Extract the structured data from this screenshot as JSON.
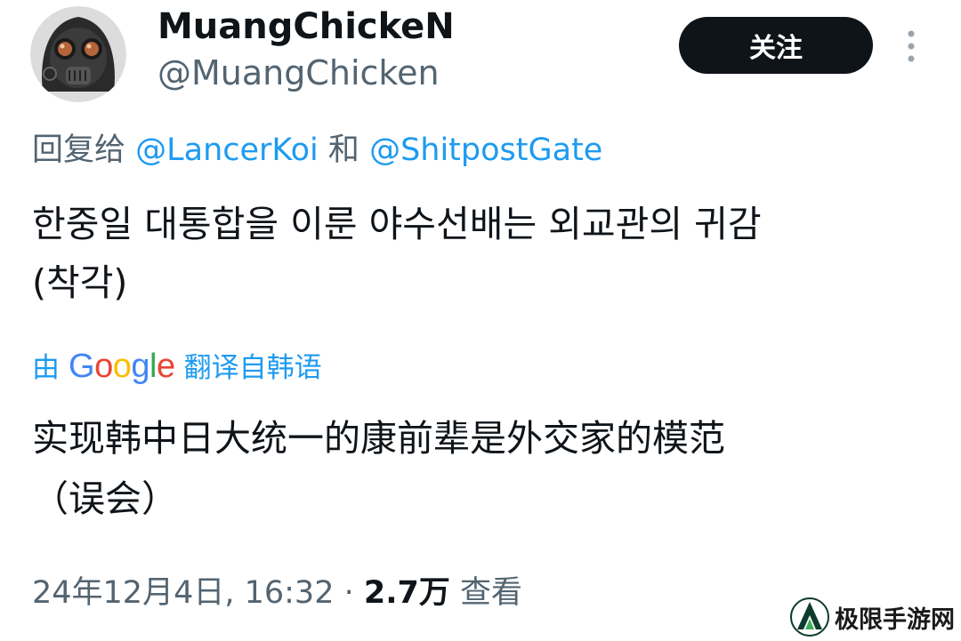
{
  "author": {
    "display_name": "MuangChickeN",
    "handle": "@MuangChicken",
    "avatar_icon": "gas-mask-avatar"
  },
  "follow_button": {
    "label": "关注"
  },
  "reply": {
    "prefix": "回复给 ",
    "mention_1": "@LancerKoi",
    "connector": " 和 ",
    "mention_2": "@ShitpostGate"
  },
  "tweet": {
    "text": "한중일 대통합을 이룬 야수선배는 외교관의 귀감\n(착각)"
  },
  "translation": {
    "prefix": "由",
    "provider": "Google",
    "suffix": "翻译自韩语",
    "text": "实现韩中日大统一的康前辈是外交家的模范\n（误会）"
  },
  "meta": {
    "timestamp": "24年12月4日, 16:32",
    "separator": " · ",
    "views_count": "2.7万",
    "views_label": " 查看"
  },
  "watermark": {
    "text": "极限手游网"
  },
  "colors": {
    "link": "#1d9bf0",
    "muted": "#536471",
    "text": "#0f1419",
    "button_bg": "#0f1419"
  }
}
